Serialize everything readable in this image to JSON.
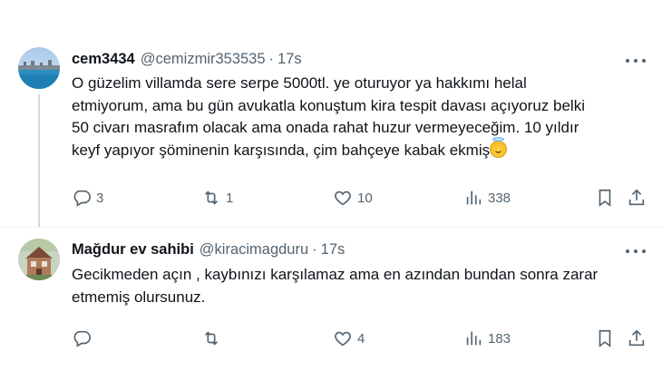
{
  "tweets": [
    {
      "display_name": "cem3434",
      "handle": "@cemizmir353535",
      "separator": "·",
      "time": "17s",
      "text": "O güzelim villamda sere serpe 5000tl. ye oturuyor ya hakkımı helal\netmiyorum, ama bu gün avukatla konuştum kira tespit davası açıyoruz belki\n50 civarı masrafım olacak ama onada rahat huzur vermeyeceğim. 10 yıldır\nkeyf yapıyor şöminenin karşısında, çim bahçeye kabak ekmiş",
      "emoji_icon": "smiling-face-with-halo-icon",
      "replies": "3",
      "retweets": "1",
      "likes": "10",
      "views": "338"
    },
    {
      "display_name": "Mağdur ev sahibi",
      "handle": "@kiracimagduru",
      "separator": "·",
      "time": "17s",
      "text": "Gecikmeden açın , kaybınızı karşılamaz ama en azından bundan sonra zarar\netmemiş olursunuz.",
      "replies": "",
      "retweets": "",
      "likes": "4",
      "views": "183"
    }
  ],
  "colors": {
    "text_primary": "#0f1419",
    "text_secondary": "#536471",
    "thread_line": "#cfd9de"
  }
}
